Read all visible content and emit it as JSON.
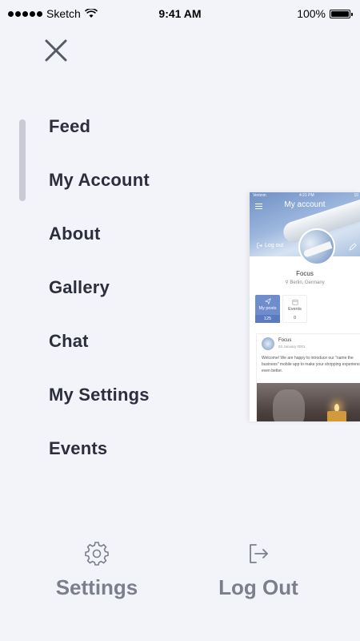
{
  "status_bar": {
    "carrier": "Sketch",
    "time": "9:41 AM",
    "battery": "100%",
    "battery_level": 1.0
  },
  "menu": {
    "items": [
      {
        "label": "Feed"
      },
      {
        "label": "My Account"
      },
      {
        "label": "About"
      },
      {
        "label": "Gallery"
      },
      {
        "label": "Chat"
      },
      {
        "label": "My Settings"
      },
      {
        "label": "Events"
      }
    ]
  },
  "preview": {
    "status_carrier": "Verizon",
    "status_time": "4:21 PM",
    "status_right": "10",
    "title": "My account",
    "logout_label": "Log out",
    "profile_name": "Focus",
    "location": "Berlin, Germany",
    "tabs": [
      {
        "label": "My posts",
        "count": "125"
      },
      {
        "label": "Events",
        "count": "0"
      }
    ],
    "post": {
      "author": "Focus",
      "date": "03 January 0001",
      "text": "Welcome! We are happy to introduce our \"name the business\" mobile app to make your shopping experience even better."
    }
  },
  "bottom": {
    "settings_label": "Settings",
    "logout_label": "Log Out"
  },
  "colors": {
    "background": "#f3f4f9",
    "menu_text": "#2d2e3d",
    "bottom_text": "#7b7f8c",
    "accent": "#6f8dcd"
  }
}
